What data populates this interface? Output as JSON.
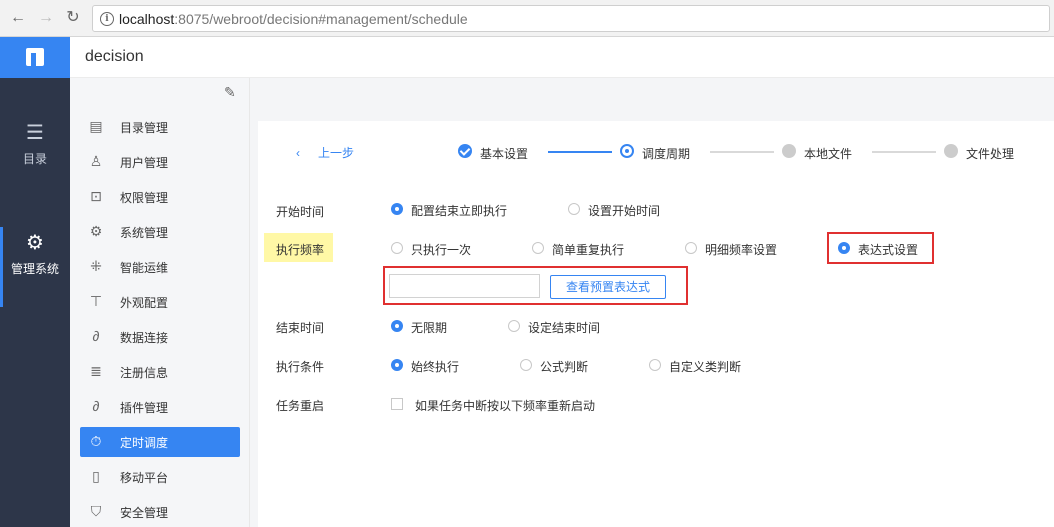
{
  "browser": {
    "url_host": "localhost",
    "url_rest": ":8075/webroot/decision#management/schedule",
    "back_icon": "arrow-left-icon",
    "forward_icon": "arrow-right-icon",
    "reload_icon": "reload-icon"
  },
  "leftnav": {
    "items": [
      {
        "label": "目录",
        "icon": "list-icon"
      },
      {
        "label": "管理系统",
        "icon": "gear-icon"
      }
    ]
  },
  "header": {
    "title": "decision"
  },
  "sidebar": {
    "items": [
      {
        "label": "目录管理",
        "icon": "catalog-icon"
      },
      {
        "label": "用户管理",
        "icon": "user-icon"
      },
      {
        "label": "权限管理",
        "icon": "lock-icon"
      },
      {
        "label": "系统管理",
        "icon": "settings-icon"
      },
      {
        "label": "智能运维",
        "icon": "network-icon"
      },
      {
        "label": "外观配置",
        "icon": "brush-icon"
      },
      {
        "label": "数据连接",
        "icon": "link-icon"
      },
      {
        "label": "注册信息",
        "icon": "register-icon"
      },
      {
        "label": "插件管理",
        "icon": "plugin-icon"
      },
      {
        "label": "定时调度",
        "icon": "timer-icon"
      },
      {
        "label": "移动平台",
        "icon": "mobile-icon"
      },
      {
        "label": "安全管理",
        "icon": "shield-icon"
      }
    ],
    "selected": "定时调度"
  },
  "wizard": {
    "back_label": "上一步",
    "steps": [
      {
        "label": "基本设置",
        "state": "done"
      },
      {
        "label": "调度周期",
        "state": "current"
      },
      {
        "label": "本地文件",
        "state": "todo"
      },
      {
        "label": "文件处理",
        "state": "todo"
      }
    ]
  },
  "form": {
    "start": {
      "label": "开始时间",
      "options": [
        "配置结束立即执行",
        "设置开始时间"
      ],
      "selected": "配置结束立即执行"
    },
    "frequency": {
      "label": "执行频率",
      "options": [
        "只执行一次",
        "简单重复执行",
        "明细频率设置",
        "表达式设置"
      ],
      "selected": "表达式设置",
      "expression_value": "",
      "preset_button": "查看预置表达式"
    },
    "end": {
      "label": "结束时间",
      "options": [
        "无限期",
        "设定结束时间"
      ],
      "selected": "无限期"
    },
    "condition": {
      "label": "执行条件",
      "options": [
        "始终执行",
        "公式判断",
        "自定义类判断"
      ],
      "selected": "始终执行"
    },
    "restart": {
      "label": "任务重启",
      "checkbox_label": "如果任务中断按以下频率重新启动",
      "checked": false
    }
  },
  "colors": {
    "accent": "#3685f2",
    "nav_bg": "#2d3649",
    "highlight": "#fff8a6",
    "annotation_red": "#e03030"
  }
}
